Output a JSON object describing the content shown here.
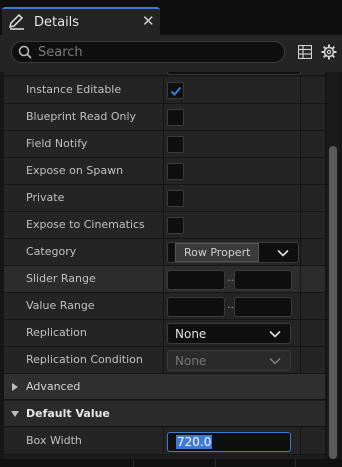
{
  "tab": {
    "title": "Details",
    "icon": "pencil-icon",
    "close_icon": "close-icon"
  },
  "search": {
    "placeholder": "Search",
    "value": ""
  },
  "toolbar": {
    "table_icon": "table-icon",
    "settings_icon": "gear-icon"
  },
  "properties": [
    {
      "label": "Instance Editable",
      "type": "checkbox",
      "checked": true
    },
    {
      "label": "Blueprint Read Only",
      "type": "checkbox",
      "checked": false
    },
    {
      "label": "Field Notify",
      "type": "checkbox",
      "checked": false
    },
    {
      "label": "Expose on Spawn",
      "type": "checkbox",
      "checked": false
    },
    {
      "label": "Private",
      "type": "checkbox",
      "checked": false
    },
    {
      "label": "Expose to Cinematics",
      "type": "checkbox",
      "checked": false
    },
    {
      "label": "Category",
      "type": "combo",
      "value": ""
    },
    {
      "label": "Slider Range",
      "type": "range"
    },
    {
      "label": "Value Range",
      "type": "range"
    },
    {
      "label": "Replication",
      "type": "combo",
      "value": "None"
    },
    {
      "label": "Replication Condition",
      "type": "combo",
      "value": "None",
      "disabled": true
    }
  ],
  "range_separator": "..",
  "tooltip": {
    "text": "Row Propert"
  },
  "advanced": {
    "label": "Advanced",
    "expanded": false
  },
  "default_value": {
    "label": "Default Value",
    "expanded": true,
    "box_width": {
      "label": "Box Width",
      "value": "720.0"
    }
  },
  "colors": {
    "accent": "#3d7ad6",
    "panel": "#242424",
    "background": "#151515"
  }
}
